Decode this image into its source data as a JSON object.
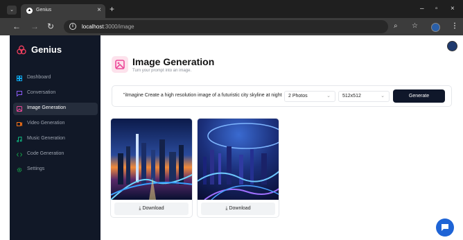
{
  "browser": {
    "tab_title": "Genius",
    "tab_close": "×",
    "new_tab": "+",
    "minimize": "–",
    "restore": "▫",
    "close": "×",
    "url_host": "localhost",
    "url_path": ":3000/image",
    "icons": [
      "menu-icon",
      "back-icon",
      "forward-icon",
      "reload-icon",
      "info-icon",
      "search-icon",
      "star-icon",
      "profile-icon",
      "more-icon"
    ]
  },
  "sidebar": {
    "brand": "Genius",
    "items": [
      {
        "label": "Dashboard",
        "icon": "dashboard-icon",
        "color": "#0ea5e9",
        "active": false
      },
      {
        "label": "Conversation",
        "icon": "chat-icon",
        "color": "#8b5cf6",
        "active": false
      },
      {
        "label": "Image Generation",
        "icon": "image-icon",
        "color": "#ec4899",
        "active": true
      },
      {
        "label": "Video Generation",
        "icon": "video-icon",
        "color": "#f97316",
        "active": false
      },
      {
        "label": "Music Generation",
        "icon": "music-icon",
        "color": "#10b981",
        "active": false
      },
      {
        "label": "Code Generation",
        "icon": "code-icon",
        "color": "#16a34a",
        "active": false
      },
      {
        "label": "Settings",
        "icon": "settings-icon",
        "color": "#16a34a",
        "active": false
      }
    ]
  },
  "main": {
    "title": "Image Generation",
    "subtitle": "Turn your prompt into an image.",
    "prompt_value": "\"iImagine Create a high resolution image of a futuristic city skyline at night",
    "amount_value": "2 Photos",
    "resolution_value": "512x512",
    "generate_label": "Generate",
    "download_label": "Download"
  },
  "colors": {
    "accent_pink": "#ec4899",
    "sidebar_bg": "#111827",
    "button_dark": "#0f172a",
    "chat_blue": "#1e64d6"
  }
}
